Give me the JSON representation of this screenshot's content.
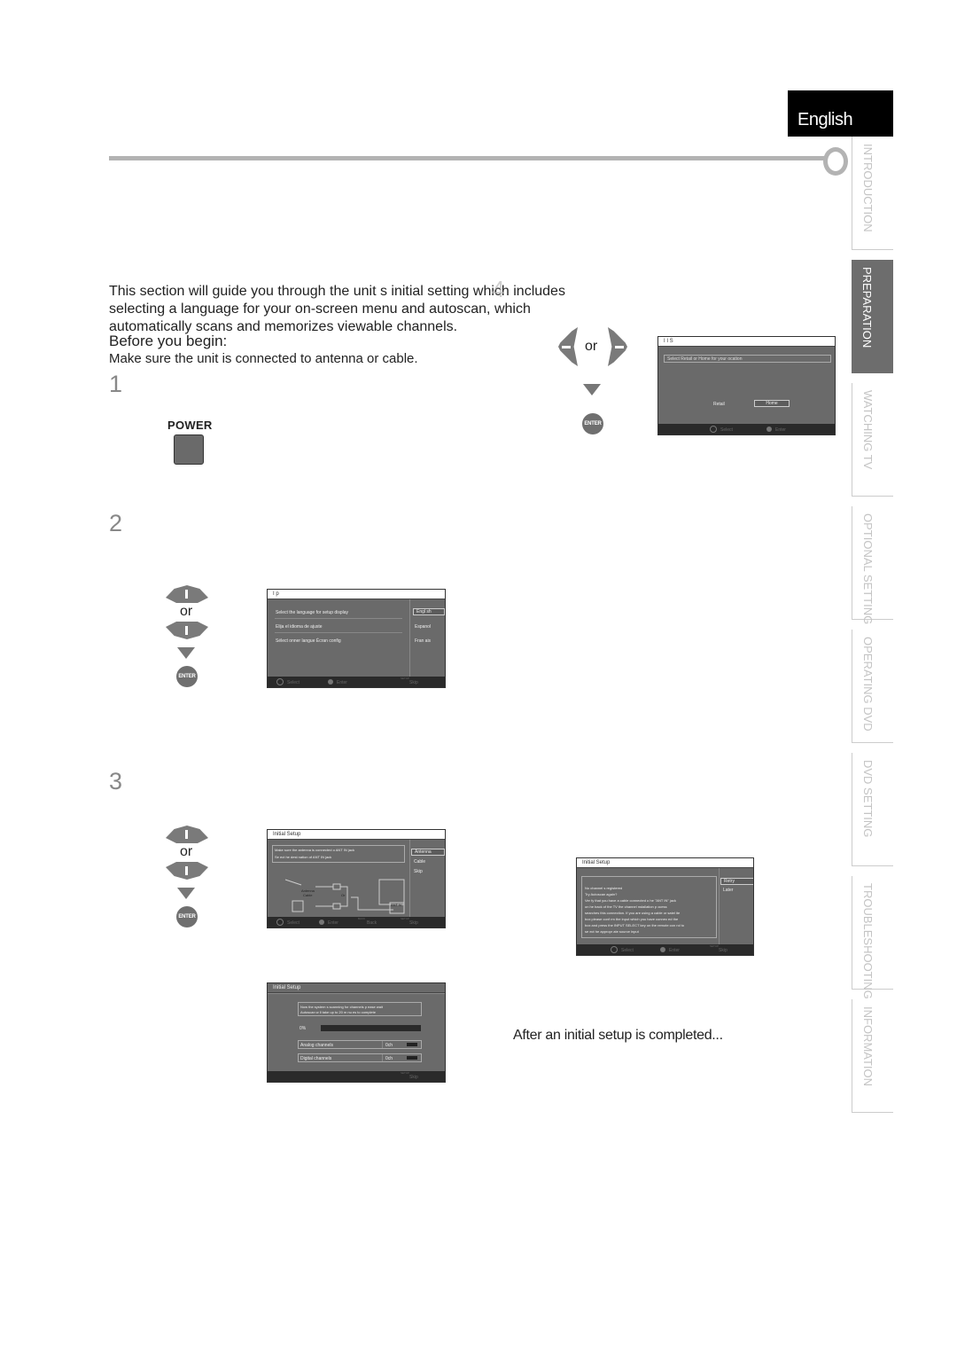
{
  "header": {
    "language_tab": "English",
    "overlay_step_marker": "4"
  },
  "side_tabs": [
    {
      "label": "INTRODUCTION",
      "active": false
    },
    {
      "label": "PREPARATION",
      "active": true
    },
    {
      "label": "WATCHING  TV",
      "active": false
    },
    {
      "label": "OPTIONAL  SETTING",
      "active": false
    },
    {
      "label": "OPERATING  DVD",
      "active": false
    },
    {
      "label": "DVD  SETTING",
      "active": false
    },
    {
      "label": "TROUBLESHOOTING",
      "active": false
    },
    {
      "label": "INFORMATION",
      "active": false
    }
  ],
  "intro": {
    "text": "This section will guide you through the unit s initial setting which includes selecting a language for your on-screen menu and autoscan, which automatically scans and memorizes viewable channels.",
    "before_title": "Before you begin:",
    "before_text": "Make sure the unit is connected to antenna or cable."
  },
  "steps": [
    {
      "number": "1"
    },
    {
      "number": "2"
    },
    {
      "number": "3"
    }
  ],
  "remote": {
    "power_label": "POWER",
    "or_label": "or",
    "enter_label": "ENTER"
  },
  "screen_location": {
    "title": "I I S",
    "prompt": "Select Retail or Home for your ocation",
    "options": [
      "Retail",
      "Home"
    ],
    "selected": "Home",
    "footer": {
      "select": "Select",
      "enter": "Enter"
    }
  },
  "screen_language": {
    "title": "I      p",
    "rows": [
      "Select the language for setup display",
      "Elija el idioma de ajuste",
      "Sélect onner langue Écran config"
    ],
    "options": [
      "Engl sh",
      "Espanol",
      "Fran ais"
    ],
    "selected": "Engl sh",
    "footer": {
      "select": "Select",
      "enter": "Enter",
      "skip_key": "SETUP",
      "skip": "Skip"
    }
  },
  "screen_antenna": {
    "title": "Initial Setup",
    "message_line1": "Make sure the antenna is connected  o ANT IN jack",
    "message_line2": "Se ect  he dest nation of  ANT IN jack",
    "options": [
      "Antenna",
      "Cable",
      "Skip"
    ],
    "selected": "Antenna",
    "diagram": {
      "antenna_label": "Antenna",
      "cable_label": "Cable",
      "or_label": "Or",
      "jack_label": "ANT N"
    },
    "footer": {
      "select": "Select",
      "enter": "Enter",
      "back_key": "BACK",
      "back": "Back",
      "skip_key": "SETUP",
      "skip": "Skip"
    }
  },
  "screen_scan": {
    "title": "Initial Setup",
    "message_line1": "Now the system  s scanning for channels p ease wait",
    "message_line2": "Autoscan w ll take up to 20 m nu es to complete",
    "progress_label": "0%",
    "progress_value": 0,
    "analog_label": "Analog channels",
    "analog_value": "0ch",
    "digital_label": "Digital channels",
    "digital_value": "0ch",
    "footer": {
      "skip_key": "SETUP",
      "skip": "Skip"
    }
  },
  "screen_nochannel": {
    "title": "Initial Setup",
    "lines": [
      "No channel  s registered",
      "Try Autoscan again?",
      "Ver fy that you have a cable connected  o  he     \"ANT IN\" jack",
      "on  he back of the TV  the channel  nstallation p ocess",
      "searches this connection. If you are using a cable or satel ite",
      "box  please conf rm the input which you have connec ed the",
      "box and press the INPUT SELECT key on the remote con rol to",
      "se ect  he appropr ate source input"
    ],
    "options": [
      "Retry",
      "Later"
    ],
    "selected": "Retry",
    "footer": {
      "select": "Select",
      "enter": "Enter",
      "skip_key": "SETUP",
      "skip": "Skip"
    }
  },
  "after": {
    "text": "After an initial setup is completed..."
  }
}
